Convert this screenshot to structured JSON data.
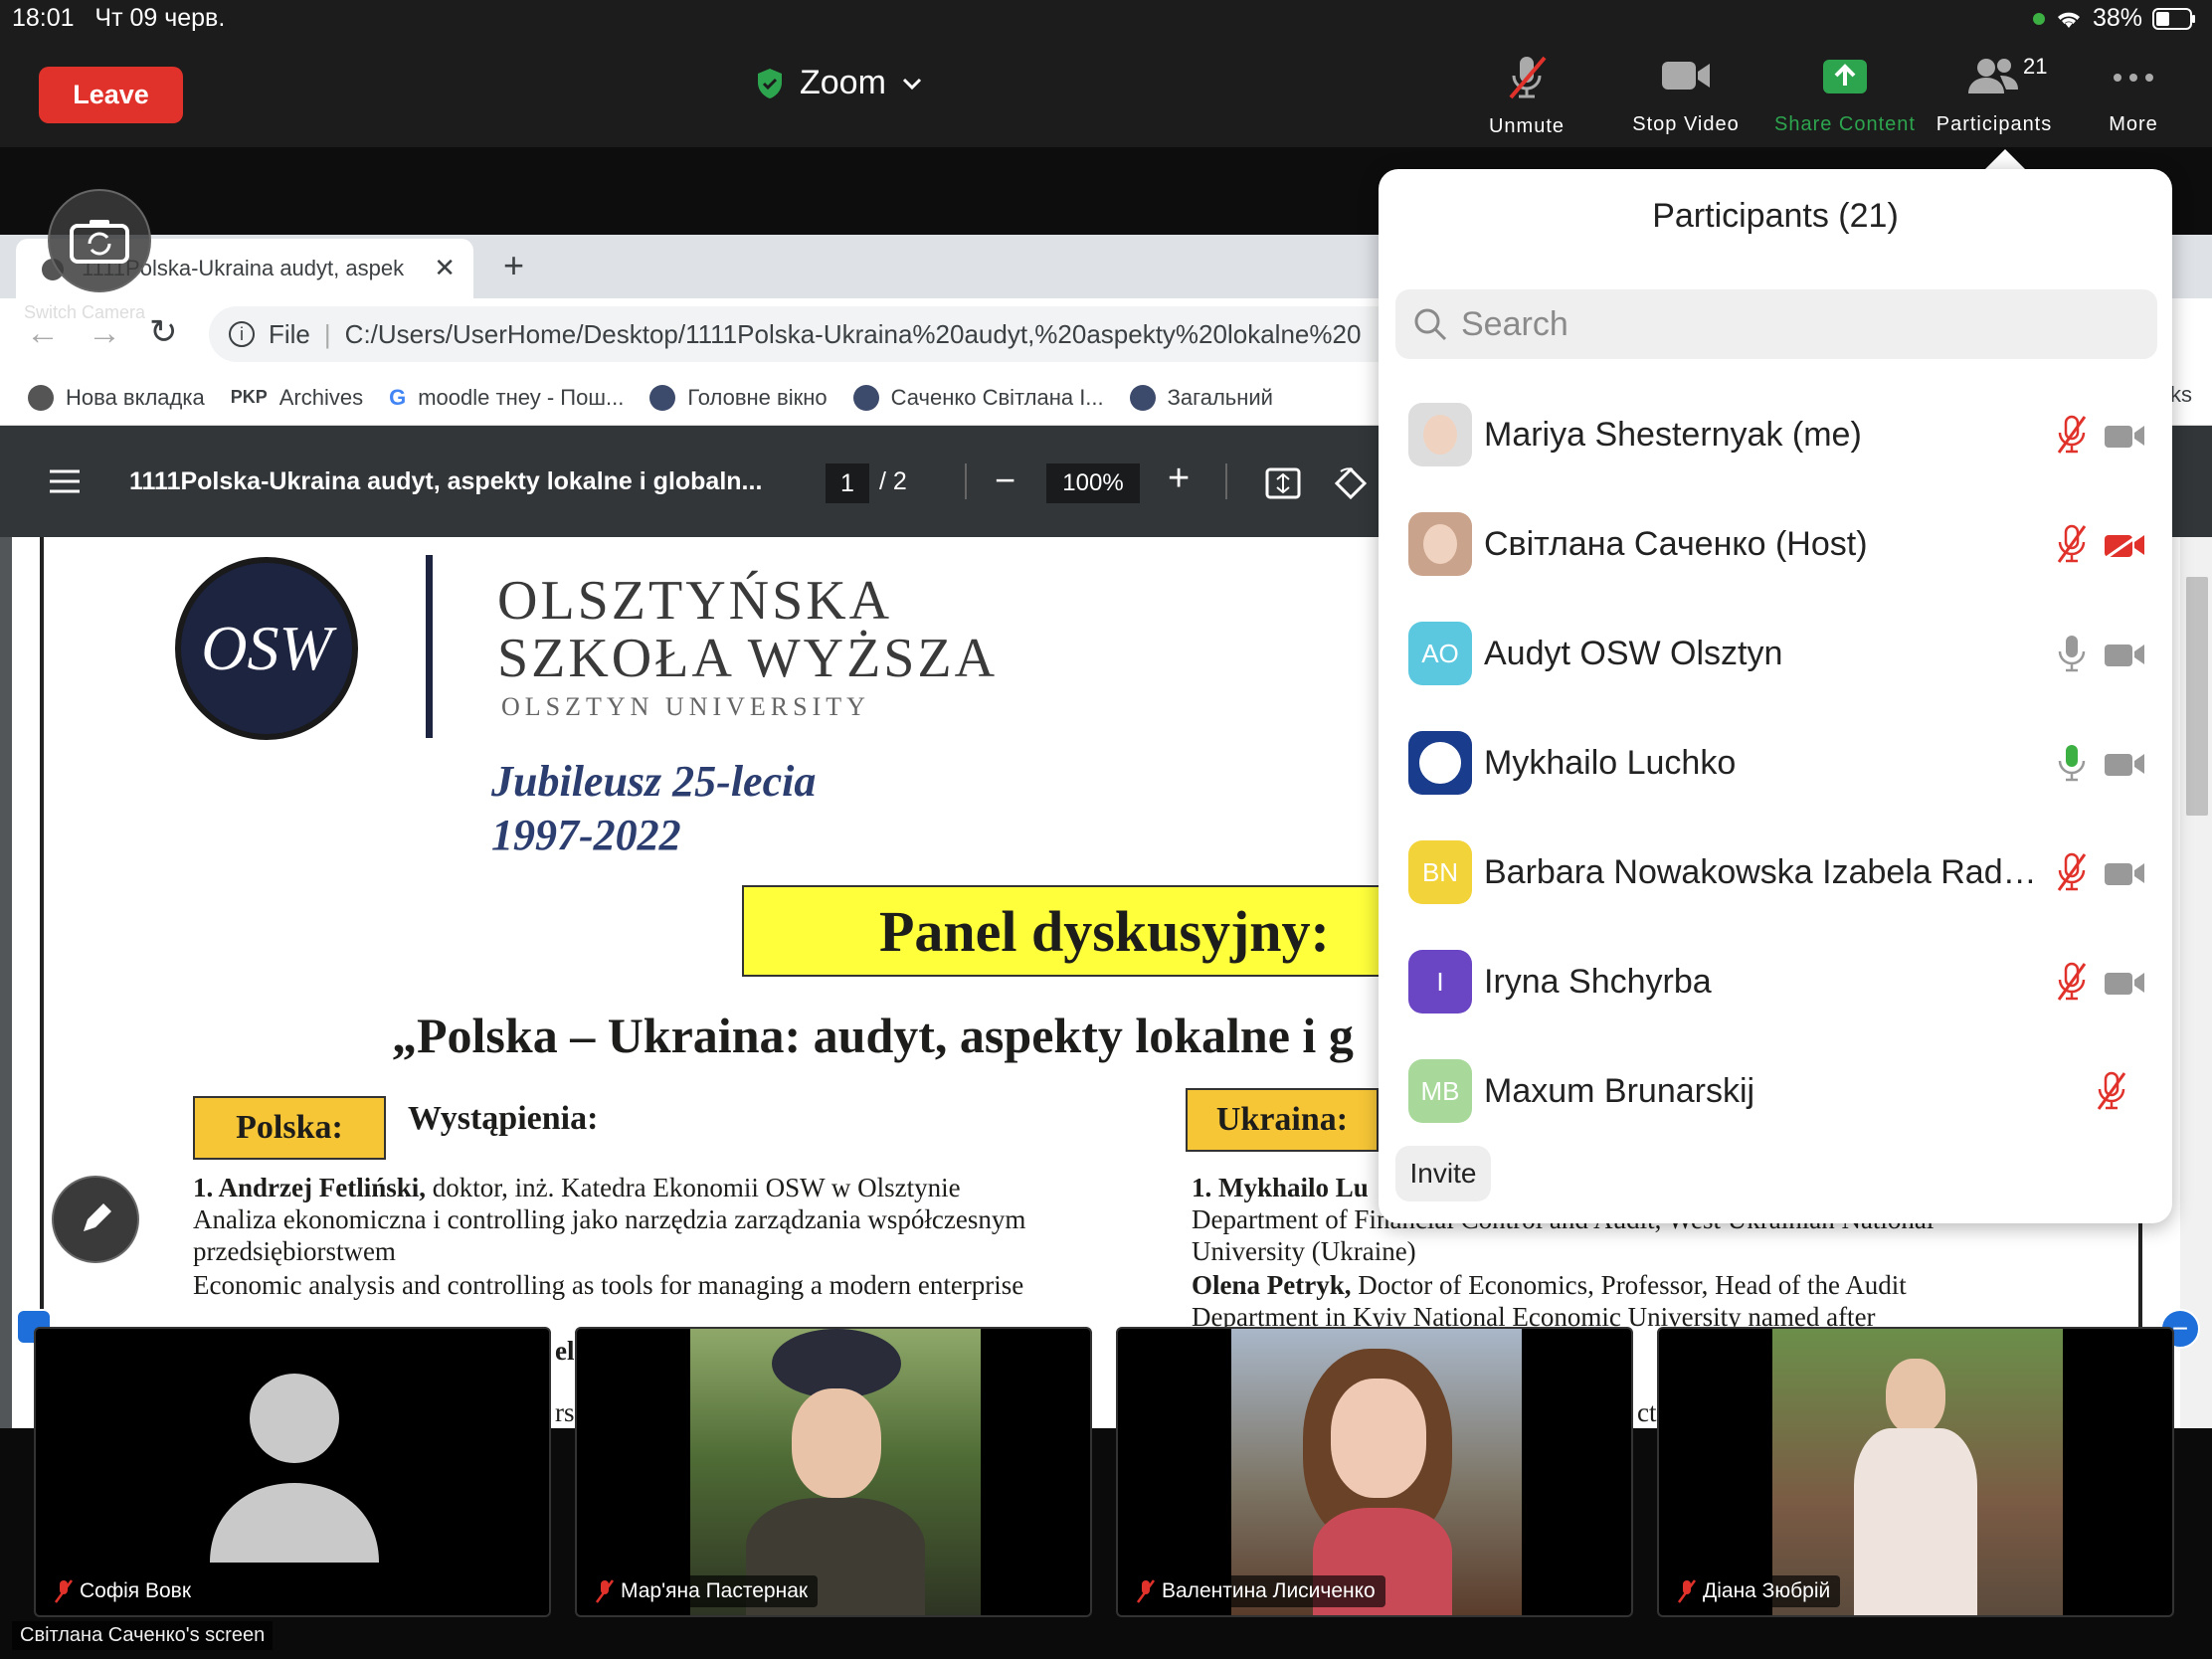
{
  "status_bar": {
    "time": "18:01",
    "date": "Чт 09 черв.",
    "battery": "38%"
  },
  "zoom_toolbar": {
    "leave_label": "Leave",
    "title": "Zoom",
    "unmute_label": "Unmute",
    "stop_video_label": "Stop Video",
    "share_content_label": "Share Content",
    "participants_label": "Participants",
    "participants_count": "21",
    "more_label": "More",
    "switch_camera_label": "Switch Camera"
  },
  "browser": {
    "tab_title": "1111Polska-Ukraina audyt, aspek",
    "address_prefix": "File",
    "address_url": "C:/Users/UserHome/Desktop/1111Polska-Ukraina%20audyt,%20aspekty%20lokalne%20",
    "bookmarks": [
      "Нова вкладка",
      "Archives",
      "moodle тнеу - Пош...",
      "Головне вікно",
      "Саченко Світлана І...",
      "Загальний"
    ],
    "bookmarks_tail": "ks"
  },
  "pdf_viewer": {
    "title": "1111Polska-Ukraina audyt, aspekty lokalne i globaln...",
    "page_current": "1",
    "page_total": "/  2",
    "zoom": "100%"
  },
  "pdf_content": {
    "logo_text": "OSW",
    "uni_line1": "OLSZTYŃSKA",
    "uni_line2": "SZKOŁA WYŻSZA",
    "uni_line3": "OLSZTYN UNIVERSITY",
    "jubilee_line1": "Jubileusz 25-lecia",
    "jubilee_line2": "1997-2022",
    "panel_heading": "Panel dyskusyjny:",
    "subtitle": "„Polska – Ukraina: audyt, aspekty lokalne i g",
    "polska_label": "Polska:",
    "wystapienia": "Wystąpienia:",
    "ukraina_label": "Ukraina:",
    "pl_line1_bold": "1. Andrzej Fetliński,",
    "pl_line1_rest": " doktor, inż. Katedra Ekonomii OSW w Olsztynie",
    "pl_line2": "Analiza ekonomiczna i controlling jako narzędzia zarządzania współczesnym",
    "pl_line3": "przedsiębiorstwem",
    "pl_line4": "Economic analysis and controlling as tools for managing a modern enterprise",
    "pl_frag1": "el",
    "pl_frag2": "rs",
    "ua_line1_bold": "1. Mykhailo Lu",
    "ua_line2": "Department of Financial Control and Audit, West Ukrainian National",
    "ua_line3": "University (Ukraine)",
    "ua_line4_bold": "Olena Petryk,",
    "ua_line4_rest": " Doctor of Economics, Professor, Head of the Audit",
    "ua_line5": "Department in Kyiv National Economic University named after",
    "ua_frag": "ct"
  },
  "participants_panel": {
    "title": "Participants (21)",
    "search_placeholder": "Search",
    "invite_label": "Invite",
    "participants": [
      {
        "name": "Mariya Shesternyak (me)",
        "initials": "",
        "avatar_color": "#ddd",
        "mic": "muted",
        "video": "on"
      },
      {
        "name": "Світлана Саченко (Host)",
        "initials": "",
        "avatar_color": "#c9a38b",
        "mic": "muted",
        "video": "off"
      },
      {
        "name": "Audyt OSW Olsztyn",
        "initials": "AO",
        "avatar_color": "#5bc8e0",
        "mic": "on",
        "video": "on"
      },
      {
        "name": "Mykhailo Luchko",
        "initials": "",
        "avatar_color": "#1a3c8c",
        "mic": "active",
        "video": "on"
      },
      {
        "name": "Barbara Nowakowska Izabela Rade...",
        "initials": "BN",
        "avatar_color": "#f2d33a",
        "mic": "muted",
        "video": "on"
      },
      {
        "name": "Iryna Shchyrba",
        "initials": "I",
        "avatar_color": "#6a45c4",
        "mic": "muted",
        "video": "on"
      },
      {
        "name": "Maxum Brunarskij",
        "initials": "MB",
        "avatar_color": "#a9d99a",
        "mic": "muted",
        "video": "none"
      }
    ]
  },
  "video_tiles": [
    {
      "name": "Софія Вовк"
    },
    {
      "name": "Мар'яна Пастернак"
    },
    {
      "name": "Валентина Лисиченко"
    },
    {
      "name": "Діана Зюбрій"
    }
  ],
  "screen_label": "Світлана Саченко's screen",
  "colors": {
    "leave": "#e0322b",
    "share": "#2da44e",
    "muted": "#e0322b",
    "mic_active": "#3cb043",
    "highlight_yellow": "#ffff3c",
    "label_gold": "#f7c637"
  }
}
